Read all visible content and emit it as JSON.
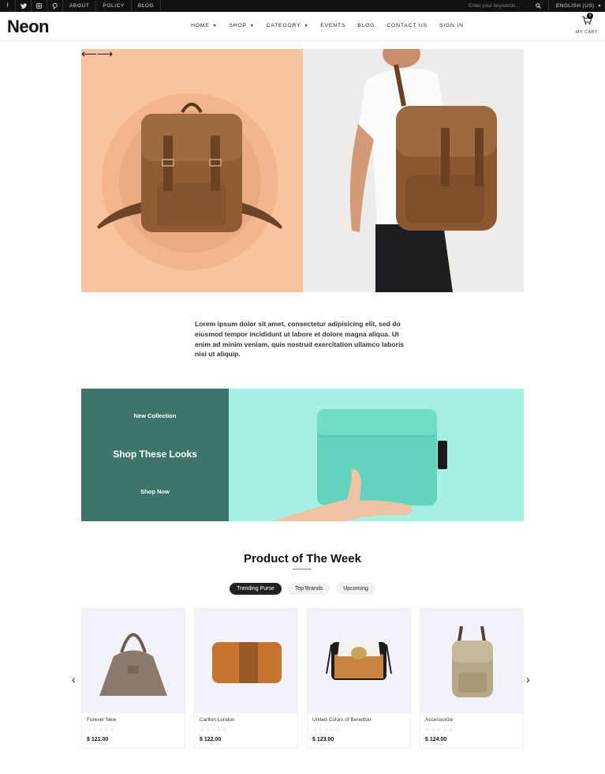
{
  "topbar": {
    "social": [
      {
        "icon": "facebook-icon",
        "glyph": "f"
      },
      {
        "icon": "twitter-icon",
        "glyph": "t"
      },
      {
        "icon": "instagram-icon",
        "glyph": "◎"
      },
      {
        "icon": "pinterest-icon",
        "glyph": "p"
      }
    ],
    "links": [
      "ABOUT",
      "POLICY",
      "BLOG"
    ],
    "search_placeholder": "Enter your keywords...",
    "language": "ENGLISH (US)"
  },
  "header": {
    "logo": "Neon",
    "nav": [
      {
        "label": "HOME",
        "dropdown": true
      },
      {
        "label": "SHOP",
        "dropdown": true
      },
      {
        "label": "CATEGORY",
        "dropdown": true
      },
      {
        "label": "EVENTS",
        "dropdown": false
      },
      {
        "label": "BLOG",
        "dropdown": false
      },
      {
        "label": "CONTACT US",
        "dropdown": false
      },
      {
        "label": "SIGN IN",
        "dropdown": false
      }
    ],
    "cart_label": "MY CART",
    "cart_count": "0"
  },
  "intro": {
    "text": "Lorem ipsum dolor sit amet, consectetur adipisicing elit, sed do eiusmod tempor incididunt ut labore et dolore magna aliqua. Ut enim ad minim veniam, quis nostrud exercitation ullamco laboris nisi ut aliquip."
  },
  "promo": {
    "eyebrow": "New Collection",
    "title": "Shop These Looks",
    "button": "Shop Now",
    "colors": {
      "dark": "#3d756b",
      "light": "#a6f0e3"
    }
  },
  "products_section": {
    "title": "Product of The Week",
    "tabs": [
      "Trending Purse",
      "Top Brands",
      "Upcoming"
    ],
    "active_tab": "Trending Purse",
    "items": [
      {
        "name": "Forever New",
        "price": "$ 121.00",
        "rating": 0
      },
      {
        "name": "Carlton London",
        "price": "$ 122.00",
        "rating": 0
      },
      {
        "name": "United Colors of Benetton",
        "price": "$ 123.00",
        "rating": 0
      },
      {
        "name": "Accessorize",
        "price": "$ 124.00",
        "rating": 0
      }
    ]
  },
  "colors": {
    "hero_left": "#f8c39d",
    "accent": "#7b6ee8",
    "topbar": "#111111"
  }
}
